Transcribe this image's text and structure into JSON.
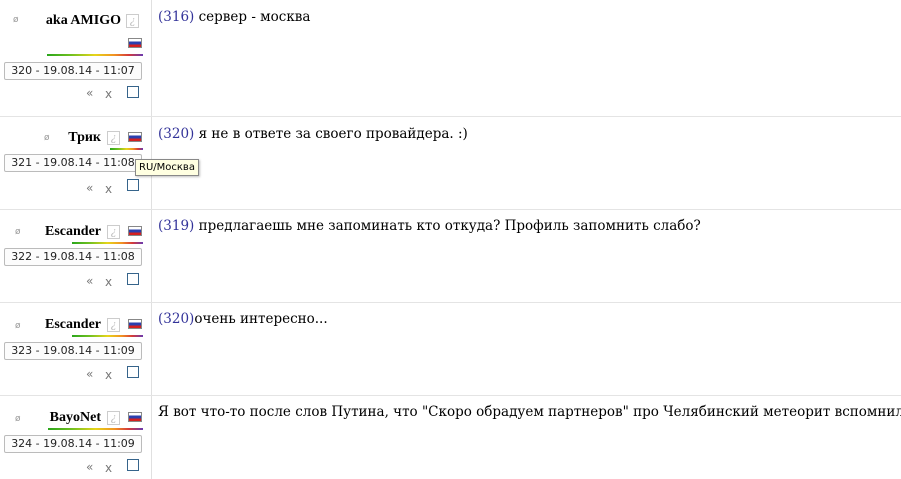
{
  "posts": [
    {
      "nick": "aka AMIGO",
      "date": "320 - 19.08.14 - 11:07",
      "ref": "(316)",
      "text": " сервер - москва",
      "quote": "«",
      "delete": "x"
    },
    {
      "nick": "Трик",
      "date": "321 - 19.08.14 - 11:08",
      "ref": "(320)",
      "text": " я не в ответе за своего провайдера. :)",
      "quote": "«",
      "delete": "x"
    },
    {
      "nick": "Escander",
      "date": "322 - 19.08.14 - 11:08",
      "ref": "(319)",
      "text": " предлагаешь мне запоминать кто откуда? Профиль запомнить слабо?",
      "quote": "«",
      "delete": "x"
    },
    {
      "nick": "Escander",
      "date": "323 - 19.08.14 - 11:09",
      "ref": "(320)",
      "text": "очень интересно...",
      "quote": "«",
      "delete": "x"
    },
    {
      "nick": "BayoNet",
      "date": "324 - 19.08.14 - 11:09",
      "ref": "",
      "text": "Я вот что-то после слов Путина, что \"Скоро обрадуем партнеров\" про Челябинский метеорит вспомнил))",
      "quote": "«",
      "delete": "x"
    }
  ],
  "tooltip": "RU/Москва",
  "qmark": "¿",
  "dot": "ø"
}
